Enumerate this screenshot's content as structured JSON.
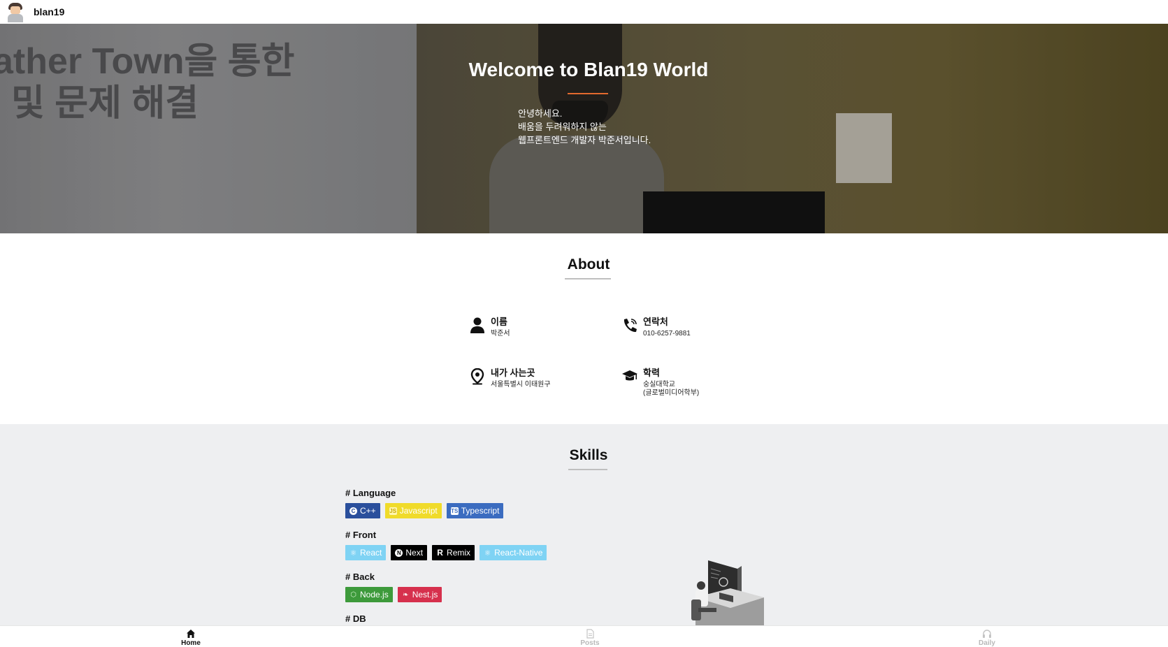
{
  "topbar": {
    "brand": "blan19"
  },
  "hero": {
    "slide_text_line1": "ather Town을 통한",
    "slide_text_line2": "및 문제 해결",
    "title": "Welcome to Blan19 World",
    "intro_line1": "안녕하세요.",
    "intro_line2": "배움을 두려워하지 않는",
    "intro_line3": "웹프론트엔드 개발자 박준서입니다."
  },
  "about": {
    "title": "About",
    "items": [
      {
        "icon": "person-icon",
        "label": "이름",
        "value": "박준서"
      },
      {
        "icon": "phone-icon",
        "label": "연락처",
        "value": "010-6257-9881"
      },
      {
        "icon": "location-pin-icon",
        "label": "내가 사는곳",
        "value": "서울특별시 이태원구"
      },
      {
        "icon": "graduation-cap-icon",
        "label": "학력",
        "value": "숭실대학교\n(글로벌미디어학부)"
      }
    ]
  },
  "skills": {
    "title": "Skills",
    "categories": [
      {
        "label": "# Language",
        "badges": [
          {
            "text": "C++",
            "color": "#00599C",
            "icon": "cplusplus-icon"
          },
          {
            "text": "Javascript",
            "color": "#F7DF1E",
            "icon": "javascript-icon"
          },
          {
            "text": "Typescript",
            "color": "#3178C6",
            "icon": "typescript-icon"
          }
        ]
      },
      {
        "label": "# Front",
        "badges": [
          {
            "text": "React",
            "color": "#61DAFB",
            "icon": "react-icon"
          },
          {
            "text": "Next",
            "color": "#000000",
            "icon": "nextjs-icon"
          },
          {
            "text": "Remix",
            "color": "#000000",
            "icon": "remix-icon"
          },
          {
            "text": "React-Native",
            "color": "#61DAFB",
            "icon": "react-icon"
          }
        ]
      },
      {
        "label": "# Back",
        "badges": [
          {
            "text": "Node.js",
            "color": "#339933",
            "icon": "nodejs-icon"
          },
          {
            "text": "Nest.js",
            "color": "#E0234E",
            "icon": "nestjs-icon"
          }
        ]
      },
      {
        "label": "# DB",
        "badges": []
      }
    ]
  },
  "bottom_nav": [
    {
      "label": "Home",
      "icon": "home-icon",
      "active": true
    },
    {
      "label": "Posts",
      "icon": "document-icon",
      "active": false
    },
    {
      "label": "Daily",
      "icon": "headphones-icon",
      "active": false
    }
  ],
  "colors": {
    "accent_underline": "#e36a2e",
    "skills_bg": "#eeeff1"
  }
}
